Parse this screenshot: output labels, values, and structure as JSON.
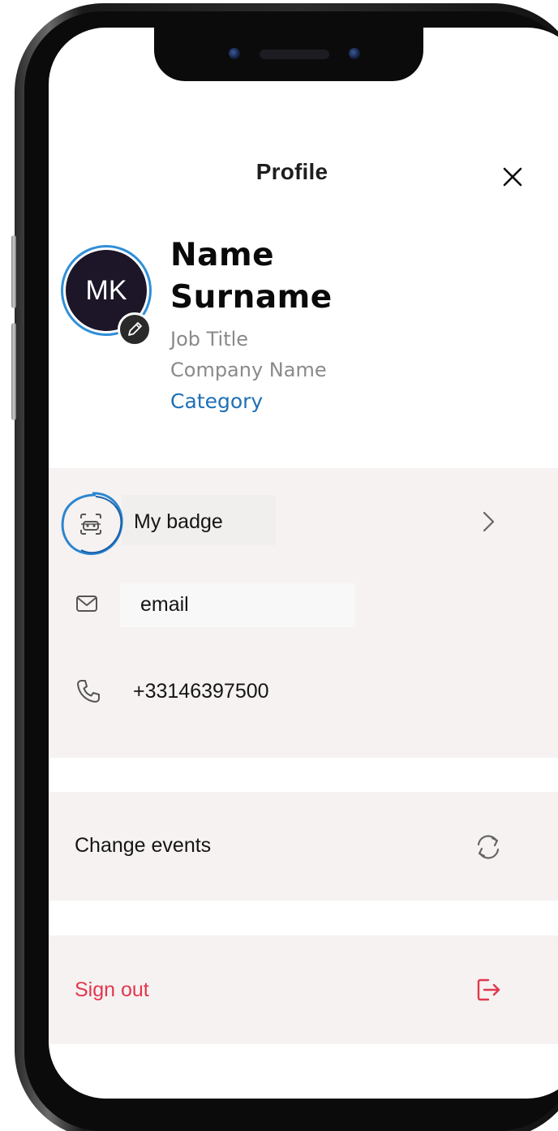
{
  "header": {
    "title": "Profile"
  },
  "profile": {
    "initials": "MK",
    "first_name": "Name",
    "last_name": "Surname",
    "job_title": "Job Title",
    "company": "Company Name",
    "category": "Category"
  },
  "contact": {
    "badge_label": "My badge",
    "email": "email",
    "phone": "+33146397500"
  },
  "actions": {
    "change_events": "Change events",
    "sign_out": "Sign out"
  },
  "colors": {
    "accent": "#1f6fb5",
    "ring": "#2f8fd8",
    "danger": "#e0384f",
    "section_bg": "#f6f2f1"
  },
  "icons": {
    "close": "close-icon",
    "edit": "pencil-icon",
    "badge": "badge-icon",
    "chevron": "chevron-right-icon",
    "email": "envelope-icon",
    "phone": "phone-icon",
    "refresh": "refresh-icon",
    "signout": "sign-out-icon"
  }
}
